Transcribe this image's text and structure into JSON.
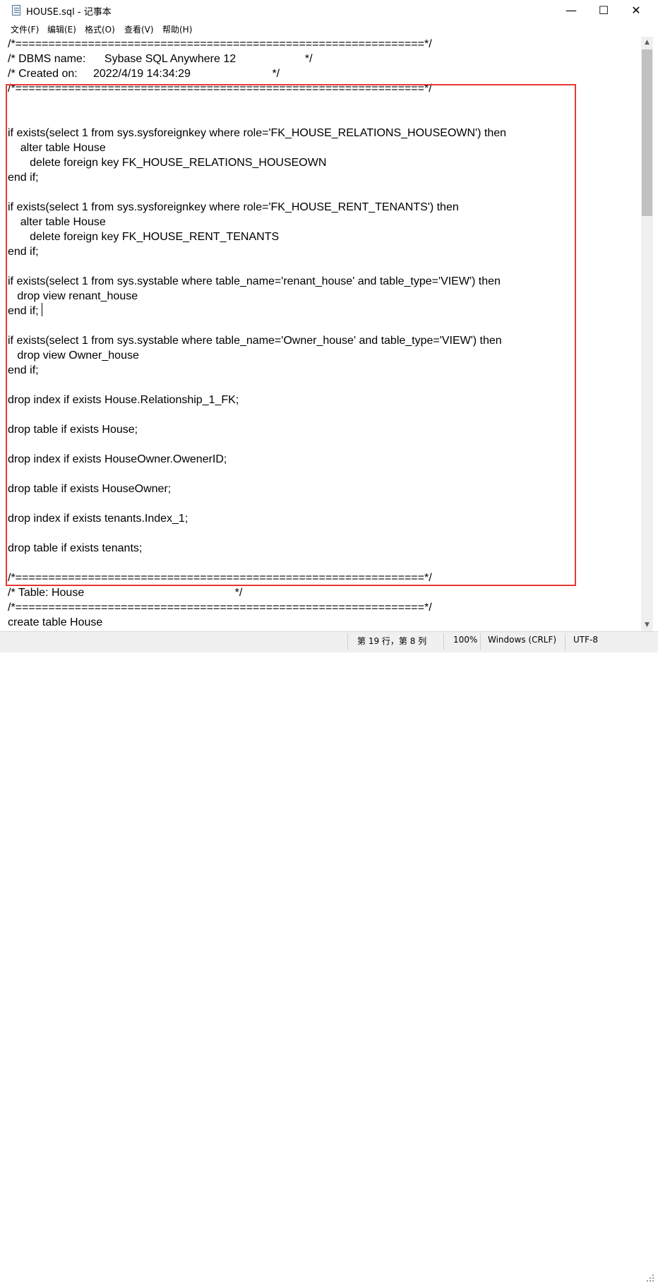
{
  "window": {
    "title": "HOUSE.sql - 记事本",
    "minimize_label": "—",
    "maximize_label": "☐",
    "close_label": "✕"
  },
  "menu": {
    "items": [
      "文件(F)",
      "编辑(E)",
      "格式(O)",
      "查看(V)",
      "帮助(H)"
    ]
  },
  "editor": {
    "lines": [
      "/*==============================================================*/",
      "/* DBMS name:      Sybase SQL Anywhere 12                      */",
      "/* Created on:     2022/4/19 14:34:29                          */",
      "/*==============================================================*/",
      "",
      "",
      "if exists(select 1 from sys.sysforeignkey where role='FK_HOUSE_RELATIONS_HOUSEOWN') then",
      "    alter table House",
      "       delete foreign key FK_HOUSE_RELATIONS_HOUSEOWN",
      "end if;",
      "",
      "if exists(select 1 from sys.sysforeignkey where role='FK_HOUSE_RENT_TENANTS') then",
      "    alter table House",
      "       delete foreign key FK_HOUSE_RENT_TENANTS",
      "end if;",
      "",
      "if exists(select 1 from sys.systable where table_name='renant_house' and table_type='VIEW') then",
      "   drop view renant_house",
      "end if;",
      "",
      "if exists(select 1 from sys.systable where table_name='Owner_house' and table_type='VIEW') then",
      "   drop view Owner_house",
      "end if;",
      "",
      "drop index if exists House.Relationship_1_FK;",
      "",
      "drop table if exists House;",
      "",
      "drop index if exists HouseOwner.OwenerID;",
      "",
      "drop table if exists HouseOwner;",
      "",
      "drop index if exists tenants.Index_1;",
      "",
      "drop table if exists tenants;",
      "",
      "/*==============================================================*/",
      "/* Table: House                                                */",
      "/*==============================================================*/",
      "create table House"
    ]
  },
  "statusbar": {
    "position": "第 19 行，第 8 列",
    "zoom": "100%",
    "line_ending": "Windows (CRLF)",
    "encoding": "UTF-8"
  },
  "colors": {
    "highlight_border": "#e53935"
  }
}
